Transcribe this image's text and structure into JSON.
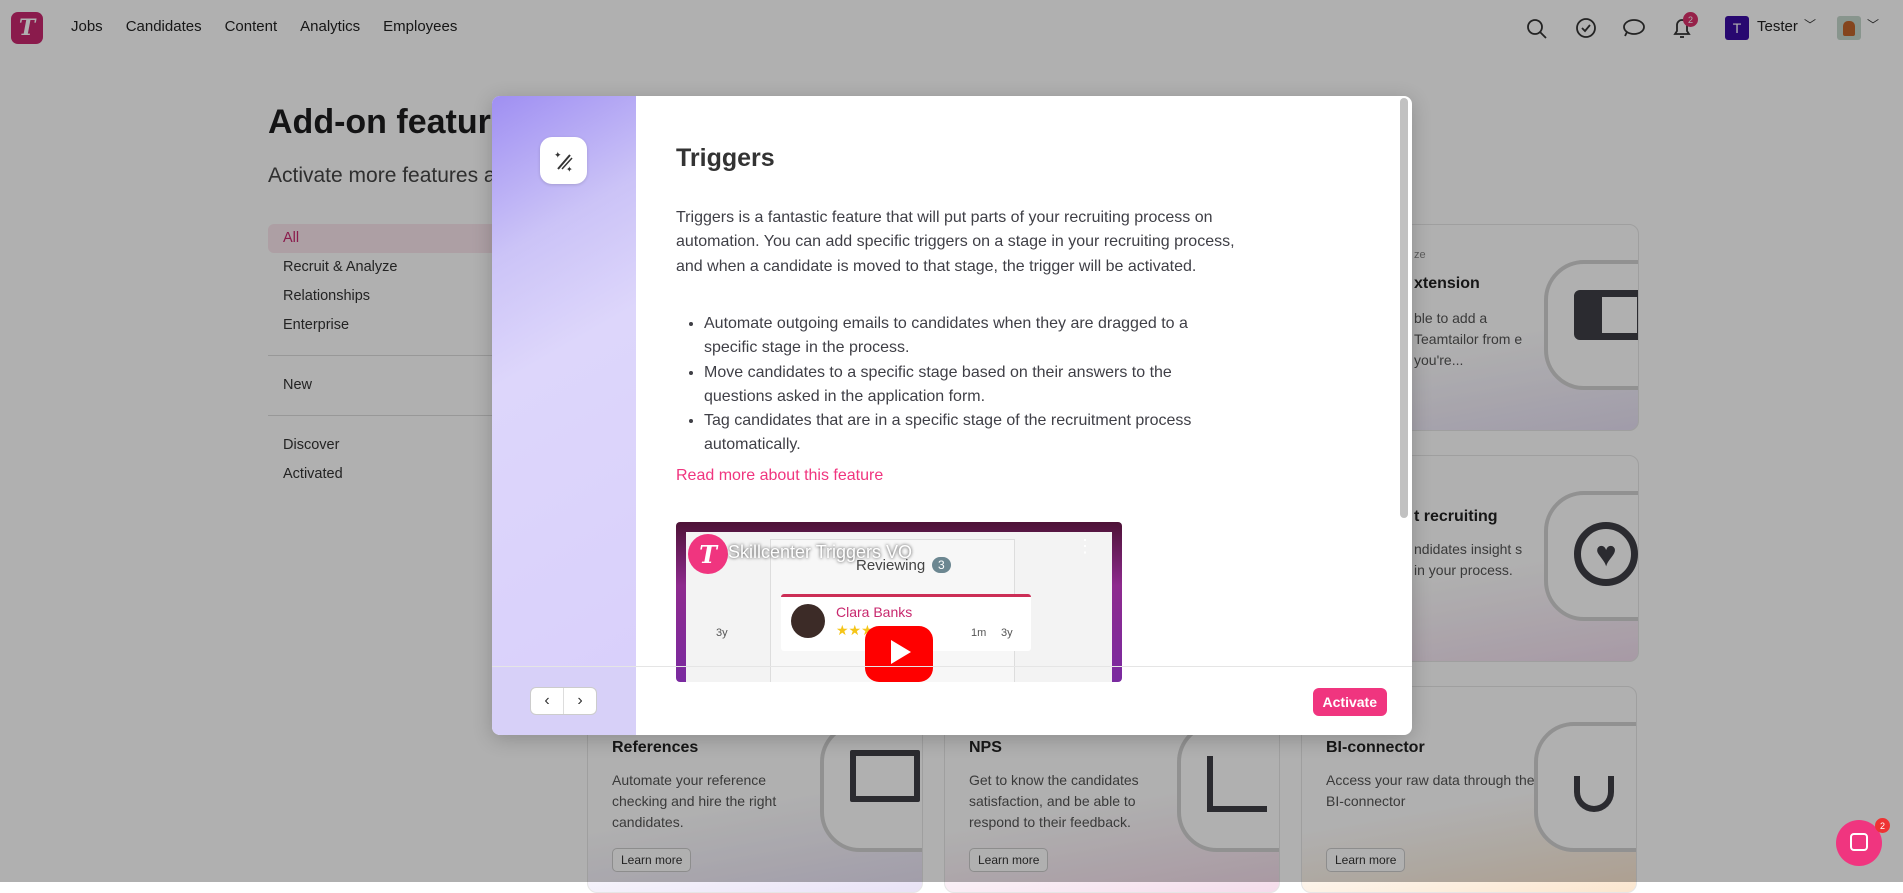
{
  "nav": {
    "logo": "T",
    "links": [
      "Jobs",
      "Candidates",
      "Content",
      "Analytics",
      "Employees"
    ],
    "notifications": "2",
    "company_initial": "T",
    "user": "Tester"
  },
  "page": {
    "title": "Add-on features",
    "subtitle": "Activate more features a",
    "sidebar": {
      "categories": [
        "All",
        "Recruit & Analyze",
        "Relationships",
        "Enterprise"
      ],
      "new": "New",
      "status": [
        "Discover",
        "Activated"
      ],
      "active": "All"
    }
  },
  "cards": [
    {
      "category": "ze",
      "title": "xtension",
      "desc": "ble to add a Teamtailor from e you're..."
    },
    {
      "title": "t recruiting",
      "desc": "ndidates insight s in your process."
    },
    {
      "title": "References",
      "desc": "Automate your reference checking and hire the right candidates.",
      "button": "Learn more"
    },
    {
      "title": "NPS",
      "desc": "Get to know the candidates satisfaction, and be able to respond to their feedback.",
      "button": "Learn more"
    },
    {
      "title": "BI-connector",
      "desc": "Access your raw data through the BI-connector",
      "button": "Learn more"
    }
  ],
  "modal": {
    "title": "Triggers",
    "description": "Triggers is a fantastic feature that will put parts of your recruiting process on automation. You can add specific triggers on a stage in your recruiting process, and when a candidate is moved to that stage, the trigger will be activated.",
    "bullets": [
      "Automate outgoing emails to candidates when they are dragged to a specific stage in the process.",
      "Move candidates to a specific stage based on their answers to the questions asked in the application form.",
      "Tag candidates that are in a specific stage of the recruitment process automatically."
    ],
    "read_more": "Read more about this feature",
    "video": {
      "title": "Skillcenter Triggers VO",
      "column": "Reviewing",
      "count": "3",
      "candidate": "Clara Banks",
      "meta1": "1m",
      "meta2": "3y",
      "meta_left": "3y"
    },
    "activate": "Activate"
  },
  "chat": {
    "badge": "2"
  },
  "colors": {
    "brand": "#f0357f",
    "logo": "#c8286e"
  }
}
